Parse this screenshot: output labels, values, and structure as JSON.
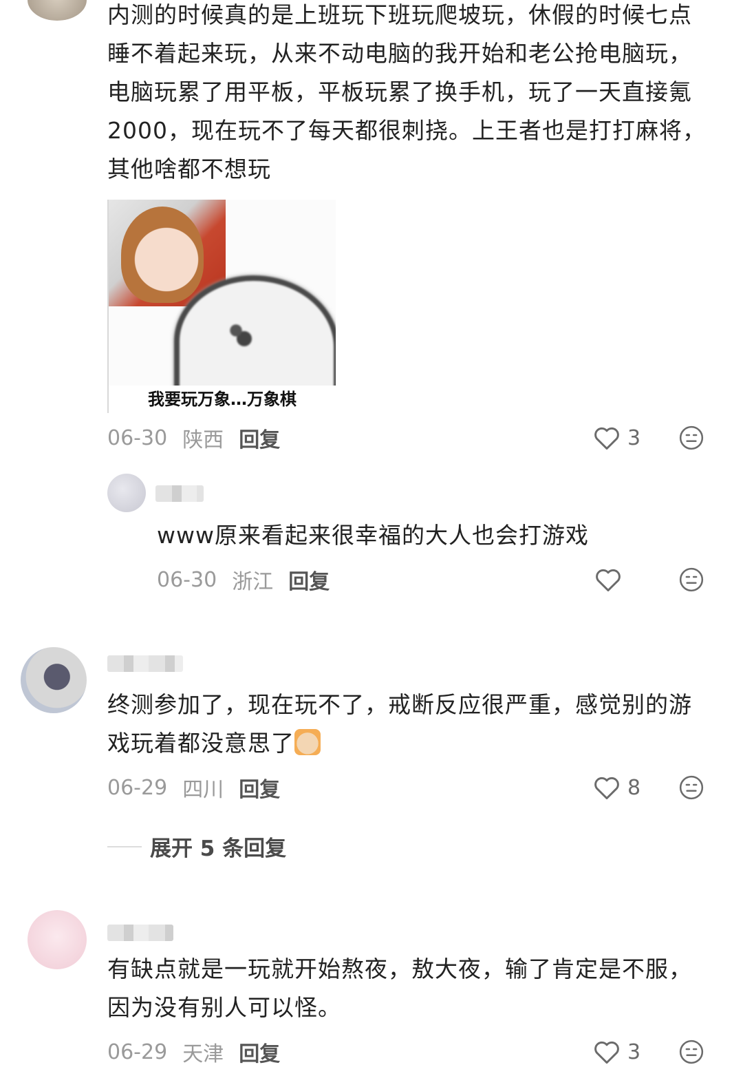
{
  "comments": [
    {
      "text_lines": [
        "内测的时候真的是上班玩下班玩爬坡玩，休假的时候七点",
        "睡不着起来玩，从来不动电脑的我开始和老公抢电脑玩，",
        "电脑玩累了用平板，平板玩累了换手机，玩了一天直接氪",
        "2000，现在玩不了每天都很刺挠。上王者也是打打麻将，",
        "其他啥都不想玩"
      ],
      "meme_caption": "我要玩万象…万象棋",
      "date": "06-30",
      "location": "陕西",
      "reply_label": "回复",
      "likes": "3"
    },
    {
      "text": "www原来看起来很幸福的大人也会打游戏",
      "date": "06-30",
      "location": "浙江",
      "reply_label": "回复",
      "likes": ""
    },
    {
      "text_lines": [
        "终测参加了，现在玩不了，戒断反应很严重，感觉别的游",
        "戏玩着都没意思了"
      ],
      "date": "06-29",
      "location": "四川",
      "reply_label": "回复",
      "likes": "8",
      "expand_label": "展开 5 条回复"
    },
    {
      "text_lines": [
        "有缺点就是一玩就开始熬夜，敖大夜，输了肯定是不服，",
        "因为没有别人可以怪。"
      ],
      "date": "06-29",
      "location": "天津",
      "reply_label": "回复",
      "likes": "3"
    }
  ],
  "icons": {
    "like": "heart-outline-icon",
    "dislike": "meh-face-icon"
  },
  "colors": {
    "text": "#222222",
    "meta": "#9a9a9a",
    "icon": "#6b6b6b"
  }
}
